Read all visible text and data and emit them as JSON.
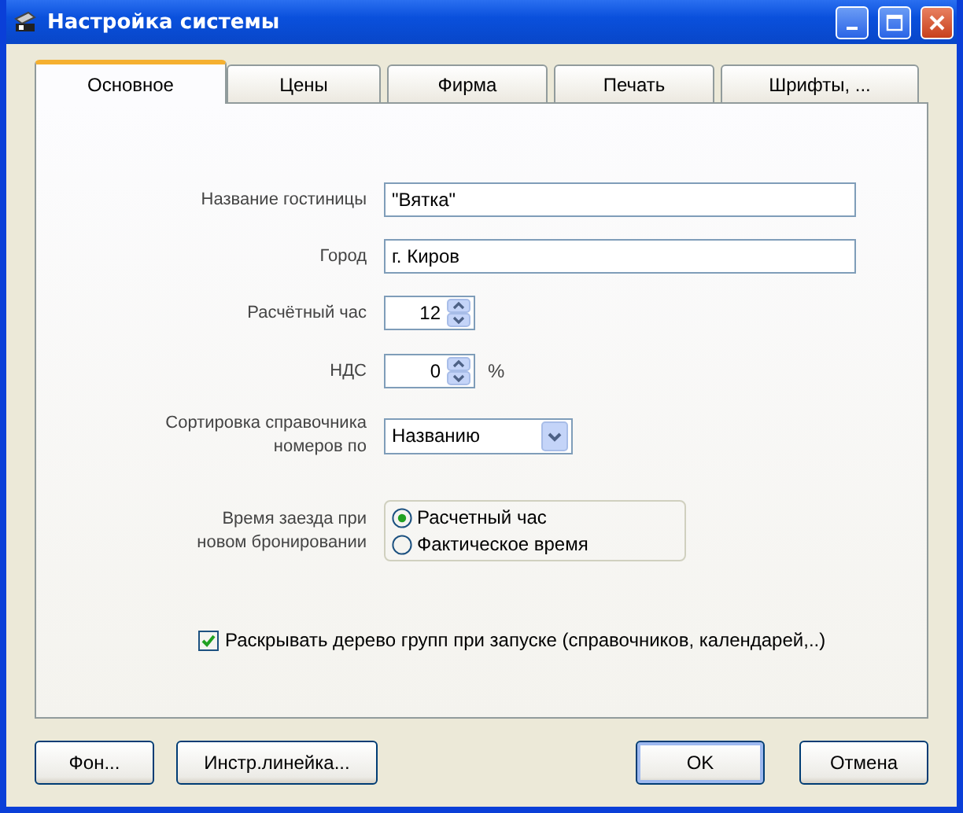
{
  "window": {
    "title": "Настройка системы"
  },
  "tabs": [
    {
      "label": "Основное",
      "selected": true
    },
    {
      "label": "Цены",
      "selected": false
    },
    {
      "label": "Фирма",
      "selected": false
    },
    {
      "label": "Печать",
      "selected": false
    },
    {
      "label": "Шрифты, ...",
      "selected": false
    }
  ],
  "fields": [
    {
      "kind": "text",
      "label": "Название гостиницы",
      "value": "\"Вятка\""
    },
    {
      "kind": "text",
      "label": "Город",
      "value": "г. Киров"
    },
    {
      "kind": "spin",
      "label": "Расчётный час",
      "value": "12"
    },
    {
      "kind": "spin",
      "label": "НДС",
      "value": "0",
      "suffix": "%"
    },
    {
      "kind": "select",
      "label": "Сортировка справочника номеров по",
      "value": "Названию"
    },
    {
      "kind": "radio",
      "label": "Время заезда при новом бронировании",
      "options": [
        {
          "label": "Расчетный час",
          "selected": true
        },
        {
          "label": "Фактическое время",
          "selected": false
        }
      ]
    }
  ],
  "checkbox": {
    "label": "Раскрывать дерево групп при запуске (справочников, календарей,..)",
    "checked": true
  },
  "buttons_left": [
    "Фон...",
    "Инстр.линейка..."
  ],
  "buttons_right": [
    "OK",
    "Отмена"
  ]
}
